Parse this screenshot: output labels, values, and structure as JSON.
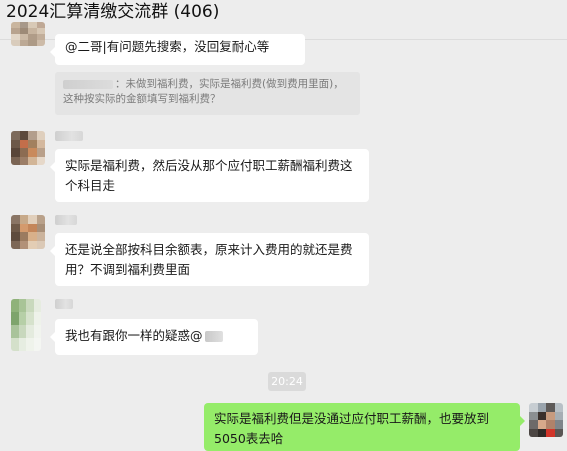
{
  "header": {
    "title": "2024汇算清缴交流群 (406)"
  },
  "messages": [
    {
      "id": "m0",
      "text": "@二哥|有问题先搜索，没回复耐心等",
      "quote": {
        "prefix": "：",
        "text": "未做到福利费，实际是福利费(做到费用里面)，这种按实际的金额填写到福利费？"
      }
    },
    {
      "id": "m1",
      "text": "实际是福利费，然后没从那个应付职工薪酬福利费这个科目走"
    },
    {
      "id": "m2",
      "text": "还是说全部按科目余额表，原来计入费用的就还是费用？不调到福利费里面"
    },
    {
      "id": "m3",
      "text": "我也有跟你一样的疑惑@"
    },
    {
      "id": "m4",
      "text": "实际是福利费但是没通过应付职工薪酬，也要放到5050表去哈"
    }
  ],
  "timestamp": "20:24",
  "colors": {
    "background": "#ededed",
    "bubble_incoming": "#ffffff",
    "bubble_outgoing": "#95ec69",
    "quote_bg": "#e4e4e4"
  }
}
